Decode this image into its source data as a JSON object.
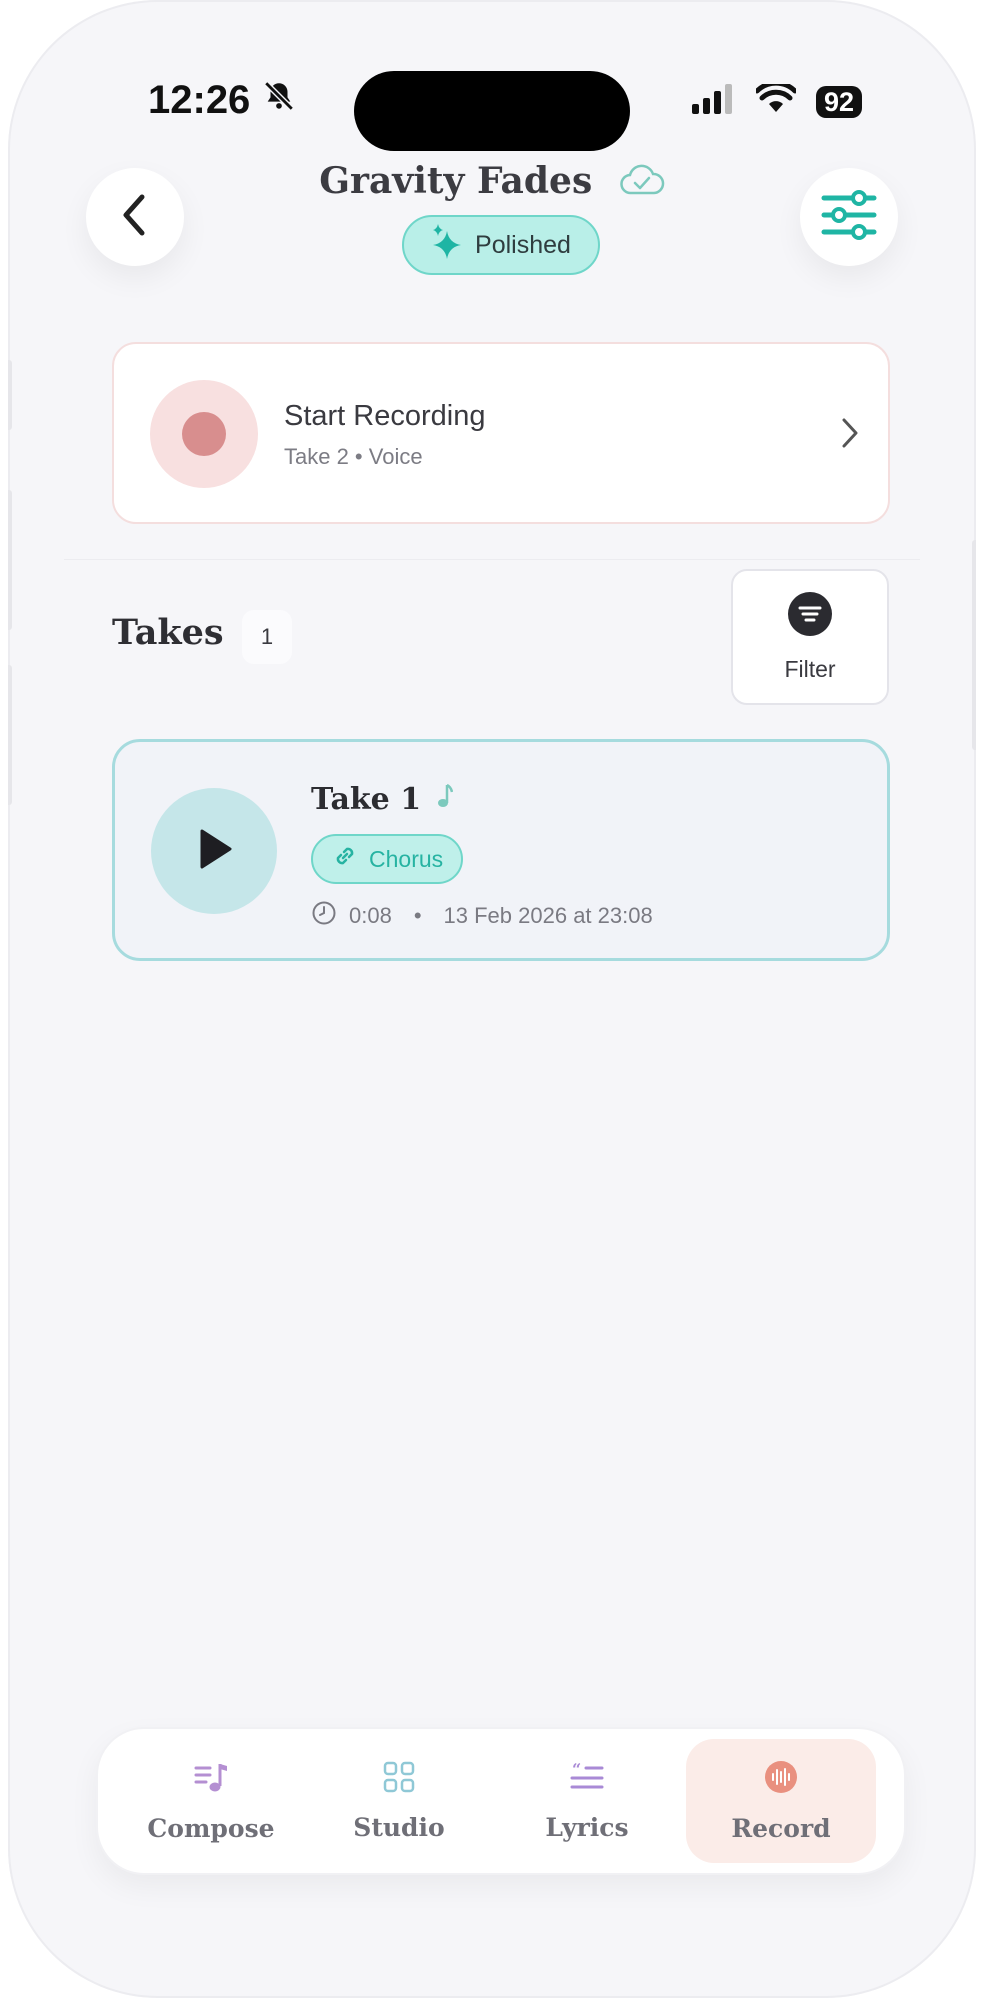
{
  "status_bar": {
    "time": "12:26",
    "battery": "92"
  },
  "header": {
    "title": "Gravity Fades",
    "status_badge": "Polished",
    "colors": {
      "accent": "#1fb5a4",
      "badge_bg": "#b9efe8"
    }
  },
  "record_card": {
    "title": "Start Recording",
    "subtitle": "Take 2 • Voice",
    "colors": {
      "dot": "#d88e8e",
      "dot_bg": "#f8e0e0"
    }
  },
  "takes": {
    "heading": "Takes",
    "count": "1",
    "filter_label": "Filter",
    "items": [
      {
        "name": "Take 1",
        "tag": "Chorus",
        "duration": "0:08",
        "separator": "•",
        "date": "13 Feb 2026 at 23:08"
      }
    ]
  },
  "tab_bar": {
    "tabs": [
      {
        "label": "Compose",
        "icon": "music-list-icon"
      },
      {
        "label": "Studio",
        "icon": "grid-icon"
      },
      {
        "label": "Lyrics",
        "icon": "quote-lines-icon"
      },
      {
        "label": "Record",
        "icon": "record-waveform-icon"
      }
    ],
    "active": "Record"
  }
}
